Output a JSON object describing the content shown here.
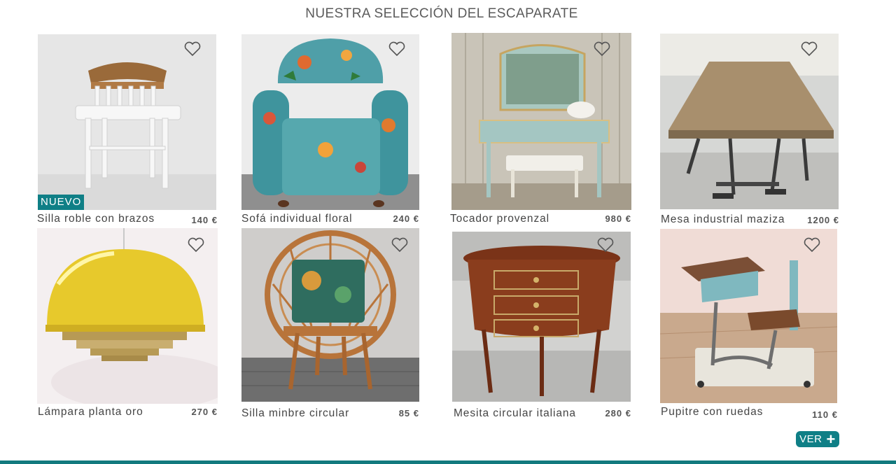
{
  "section": {
    "title": "NUESTRA SELECCIÓN DEL ESCAPARATE"
  },
  "products": [
    {
      "name": "Silla  roble con brazos",
      "price": "140 €",
      "badge": "NUEVO"
    },
    {
      "name": "Sofá individual floral",
      "price": "240 €"
    },
    {
      "name": "Tocador provenzal",
      "price": "980 €"
    },
    {
      "name": "Mesa industrial maziza",
      "price": "1200 €"
    },
    {
      "name": "Lámpara planta oro",
      "price": "270 €"
    },
    {
      "name": "Silla minbre circular",
      "price": "85 €"
    },
    {
      "name": "Mesita circular italiana",
      "price": "280 €"
    },
    {
      "name": "Pupitre con ruedas",
      "price": "110 €"
    }
  ],
  "more_button": {
    "label": "VER",
    "icon": "plus-icon"
  },
  "colors": {
    "accent": "#0f7f86",
    "bottom_bar": "#137a7e"
  }
}
